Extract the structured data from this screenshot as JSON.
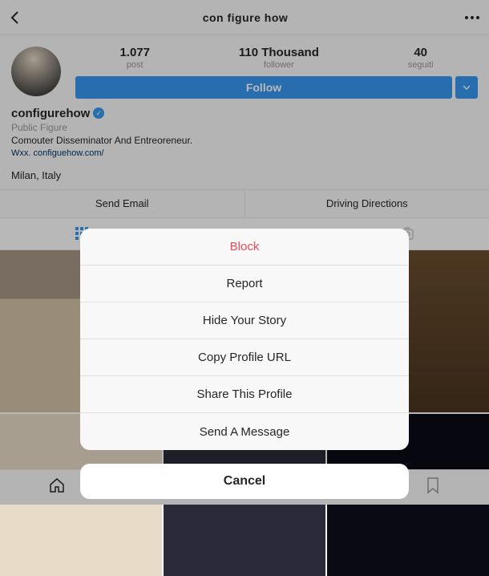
{
  "header": {
    "title": "con figure how"
  },
  "profile": {
    "username": "configurehow",
    "category": "Public Figure",
    "bio": "Comouter Disseminator And Entreoreneur.",
    "link": "Wxx. configuehow.com/",
    "location": "Milan, Italy"
  },
  "stats": {
    "posts": {
      "value": "1.077",
      "label": "post"
    },
    "followers": {
      "value": "110 Thousand",
      "label": "follower"
    },
    "following": {
      "value": "40",
      "label": "seguiti"
    }
  },
  "buttons": {
    "follow": "Follow",
    "sendEmail": "Send Email",
    "directions": "Driving Directions"
  },
  "sheet": {
    "block": "Block",
    "report": "Report",
    "hide": "Hide Your Story",
    "copy": "Copy Profile URL",
    "share": "Share This Profile",
    "message": "Send A Message",
    "cancel": "Cancel"
  }
}
